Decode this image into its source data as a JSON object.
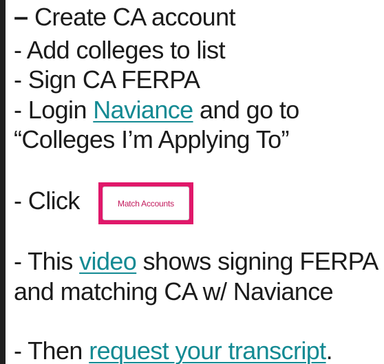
{
  "steps": {
    "step1": {
      "dash": "–",
      "text": "Create CA account"
    },
    "step2": {
      "text": "- Add colleges to list"
    },
    "step3": {
      "text": "- Sign CA FERPA"
    },
    "step4": {
      "prefix": "- Login ",
      "link": "Naviance",
      "suffix": " and go to",
      "line2": "“Colleges I’m Applying To”"
    },
    "step5": {
      "prefix": "- Click",
      "button_label": "Match Accounts"
    },
    "step6": {
      "prefix": "- This ",
      "link": "video",
      "suffix": " shows signing FERPA",
      "line2": "and matching CA w/ Naviance"
    },
    "step7": {
      "prefix": "- Then ",
      "link": "request your transcript",
      "suffix": "."
    }
  },
  "colors": {
    "text": "#1b1b1b",
    "link": "#138a93",
    "button_border": "#e0186a",
    "button_text": "#c2185b"
  }
}
